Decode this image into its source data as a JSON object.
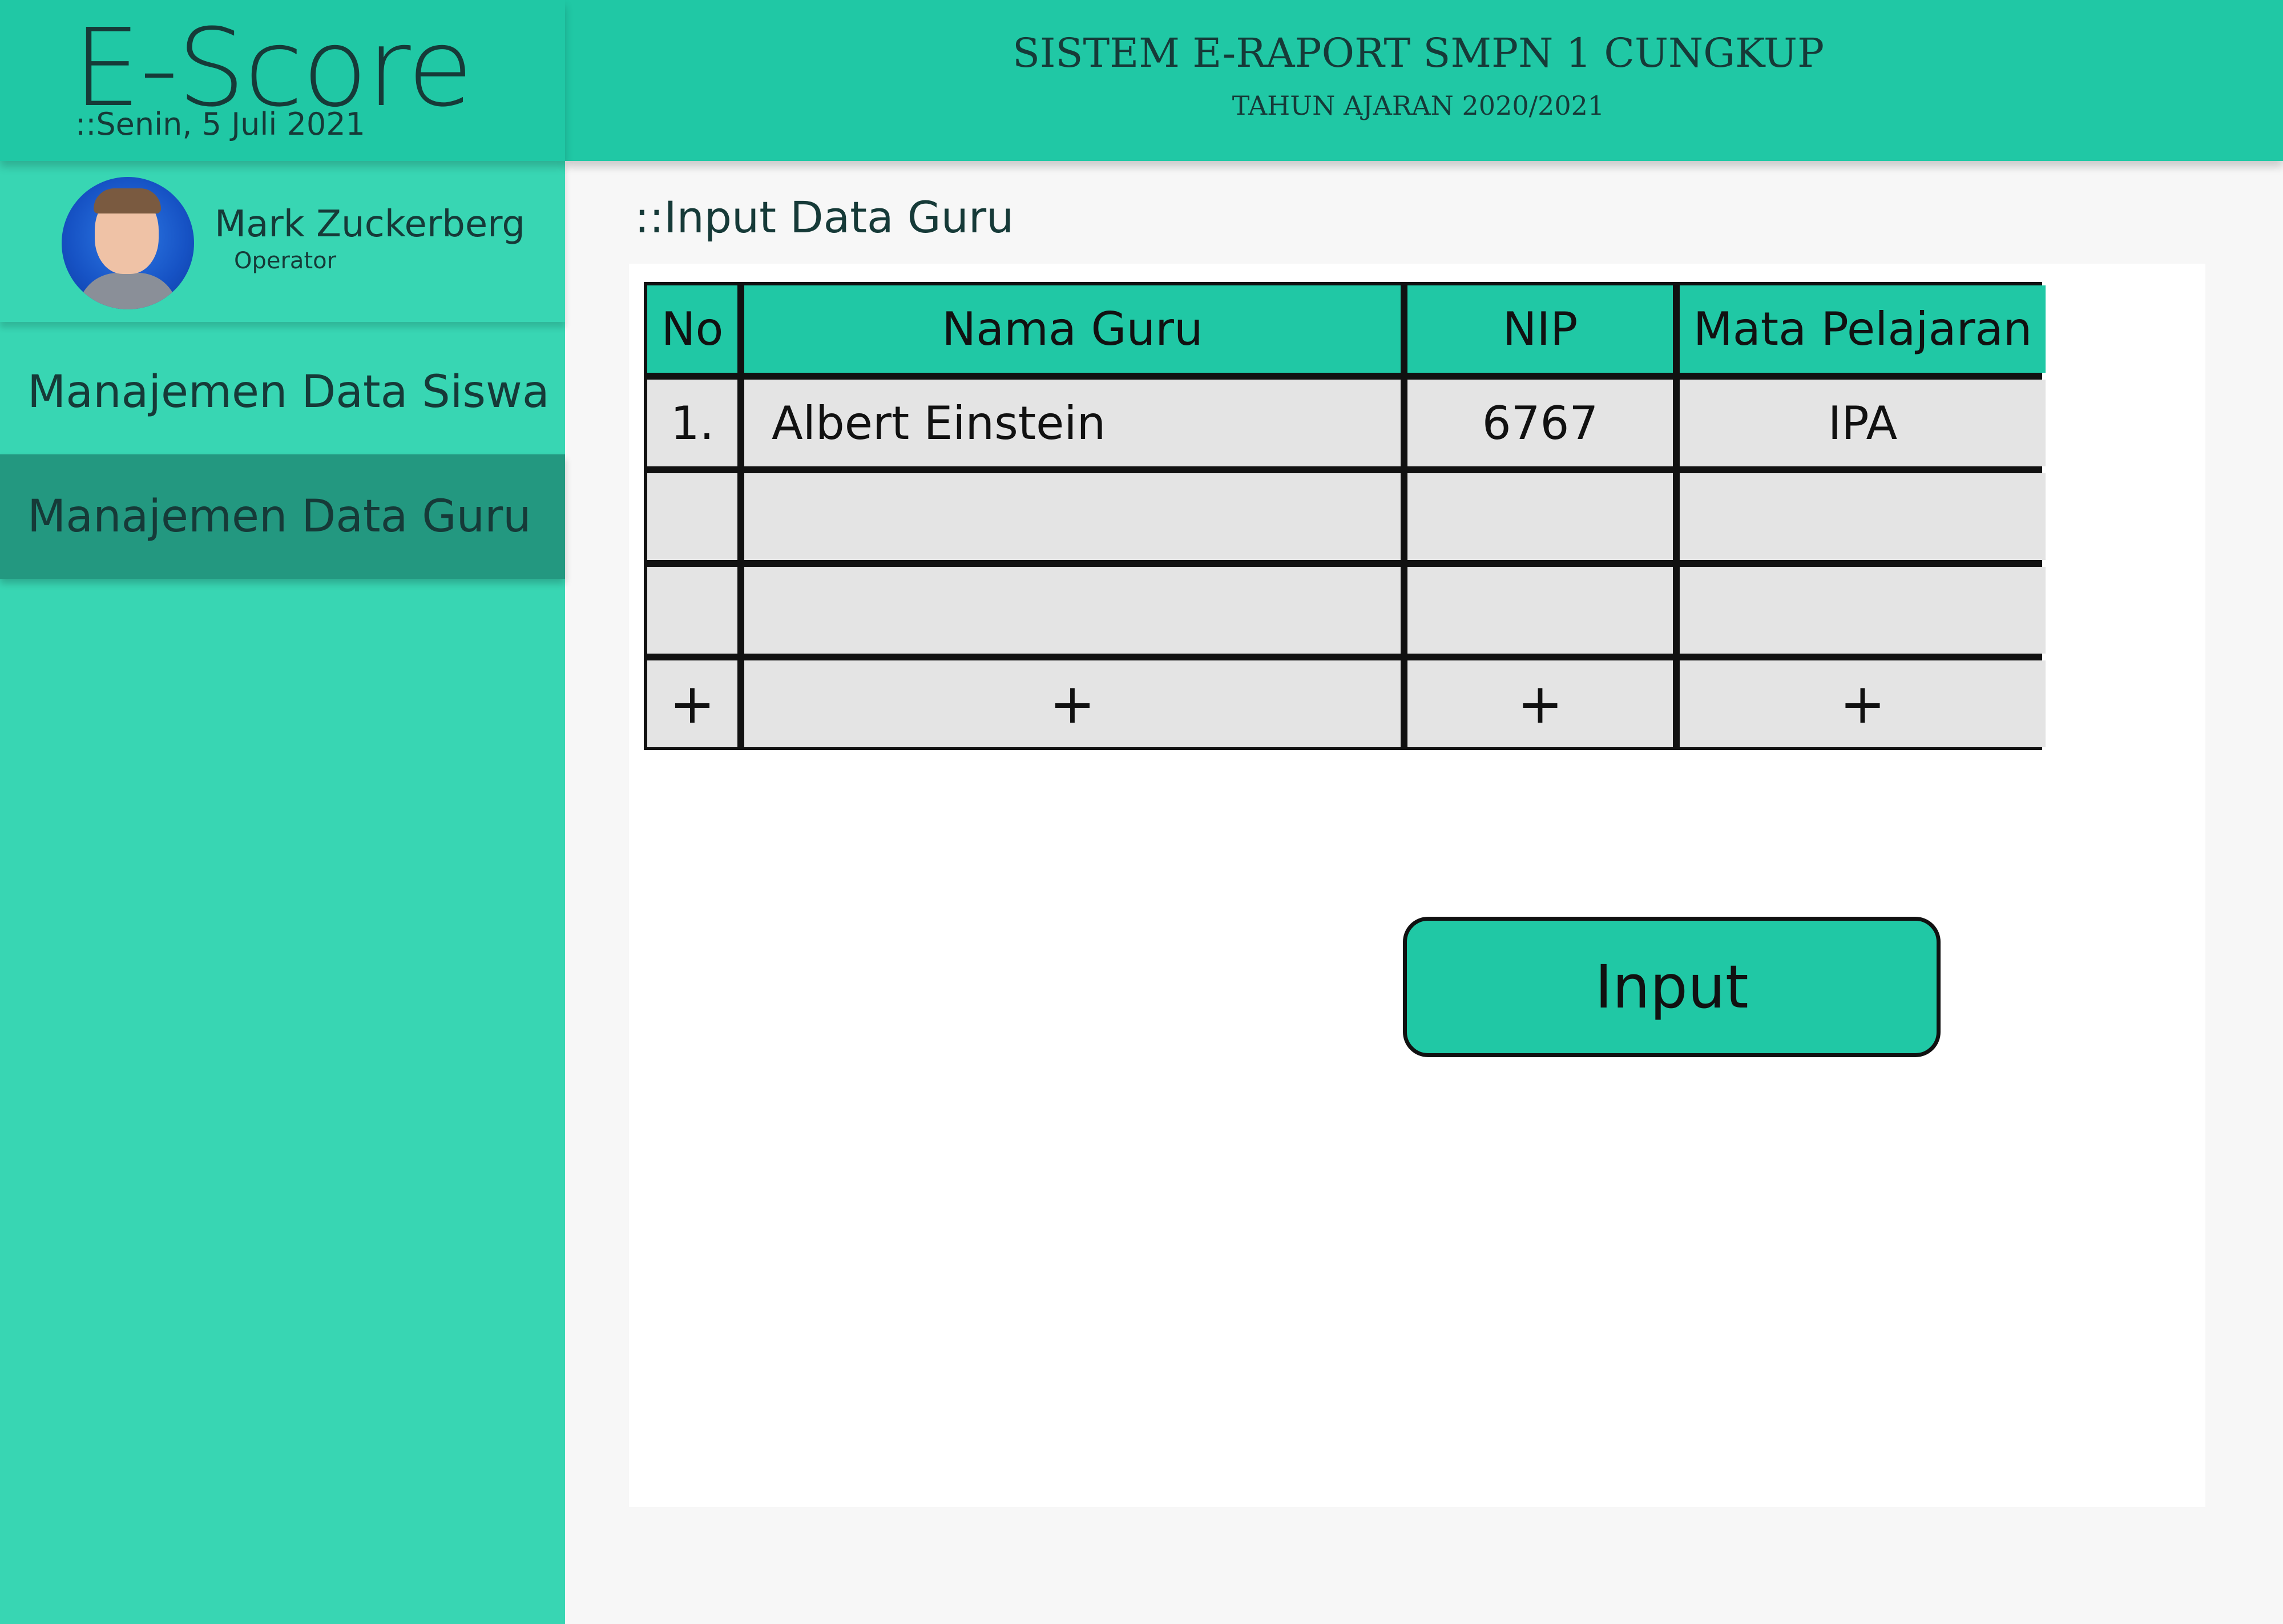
{
  "app": {
    "logo": "E-Score",
    "date": "::Senin, 5 Juli 2021"
  },
  "header": {
    "title": "SISTEM E-RAPORT SMPN 1 CUNGKUP",
    "subtitle": "TAHUN AJARAN 2020/2021"
  },
  "user": {
    "name": "Mark Zuckerberg",
    "role": "Operator"
  },
  "sidebar": {
    "items": [
      {
        "label": "Manajemen Data Siswa",
        "active": false
      },
      {
        "label": "Manajemen Data Guru",
        "active": true
      }
    ]
  },
  "main": {
    "section_title": "::Input Data Guru",
    "table": {
      "columns": [
        "No",
        "Nama Guru",
        "NIP",
        "Mata Pelajaran"
      ],
      "rows": [
        [
          "1.",
          "Albert Einstein",
          "6767",
          "IPA"
        ],
        [
          "",
          "",
          "",
          ""
        ],
        [
          "",
          "",
          "",
          ""
        ]
      ],
      "add_row": [
        "+",
        "+",
        "+",
        "+"
      ]
    },
    "input_button": "Input"
  },
  "colors": {
    "accent": "#20c8a5",
    "sidebar": "#38d6b3",
    "sidebar_active": "#239880"
  }
}
